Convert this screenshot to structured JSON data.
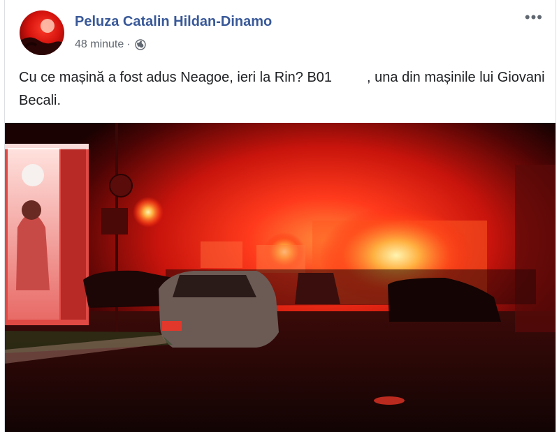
{
  "post": {
    "author": "Peluza Catalin Hildan-Dinamo",
    "time": "48 minute",
    "separator": "·",
    "privacy_icon": "globe-icon",
    "more_icon": "more-options-icon",
    "more_glyph": "•••",
    "text_part1": "Cu ce mașină a fost adus Neagoe, ieri la Rin? B01",
    "text_part2": ", una din mașinile lui Giovani Becali."
  },
  "photo": {
    "description_icon": "photo-image"
  },
  "colors": {
    "link": "#385898",
    "secondary": "#606770",
    "text": "#1c1e21"
  }
}
